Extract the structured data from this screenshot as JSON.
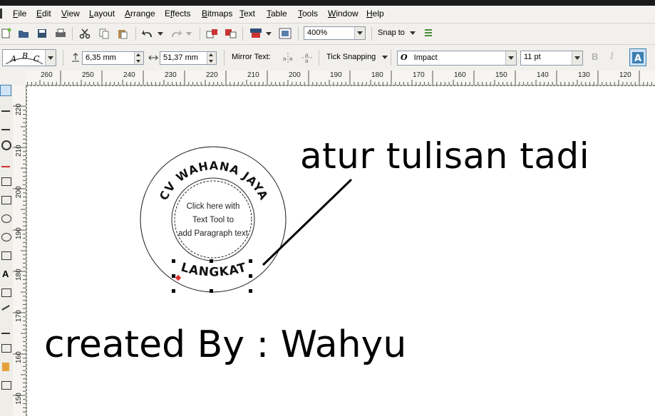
{
  "menu": {
    "items": [
      "File",
      "Edit",
      "View",
      "Layout",
      "Arrange",
      "Effects",
      "Bitmaps",
      "Text",
      "Table",
      "Tools",
      "Window",
      "Help"
    ],
    "underline": [
      "F",
      "E",
      "V",
      "L",
      "A",
      "f",
      "B",
      "T",
      "T",
      "T",
      "W",
      "H"
    ]
  },
  "toolbar": {
    "zoom": "400%",
    "snap_label": "Snap to"
  },
  "property_bar": {
    "offset_value": "6,35 mm",
    "distance_value": "51,37 mm",
    "mirror_label": "Mirror Text:",
    "tick_snapping_label": "Tick Snapping",
    "font_name": "Impact",
    "font_size": "11 pt",
    "bold_label": "B",
    "italic_label": "I",
    "text_preset": "ABC"
  },
  "rulers": {
    "horizontal": [
      "260",
      "250",
      "240",
      "230",
      "220",
      "210",
      "200",
      "190",
      "180",
      "170",
      "160",
      "150",
      "140",
      "130",
      "120"
    ],
    "vertical": [
      "220",
      "210",
      "200",
      "190",
      "180",
      "170",
      "160",
      "150"
    ]
  },
  "canvas": {
    "seal_top_text": "CV WAHANA JAYA",
    "seal_bottom_text": "LANGKAT",
    "seal_center_text": [
      "Click here with",
      "Text Tool to",
      "add Paragraph text"
    ],
    "annotation": "atur tulisan tadi",
    "credit": "created By : Wahyu"
  },
  "colors": {
    "accent": "#3c7fb1",
    "toolbar_bg": "#f1f0ec"
  }
}
